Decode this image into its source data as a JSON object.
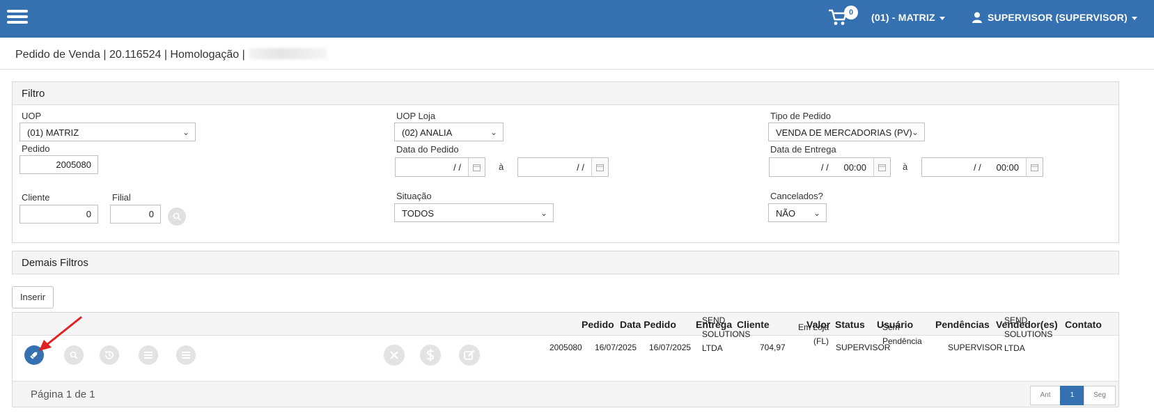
{
  "topbar": {
    "cart_count": "0",
    "branch_label": "(01) - MATRIZ",
    "user_label": "SUPERVISOR (SUPERVISOR)"
  },
  "header": {
    "title": "Pedido de Venda | 20.116524 | Homologação |"
  },
  "filtro": {
    "title": "Filtro",
    "uop": {
      "label": "UOP",
      "value": "(01) MATRIZ"
    },
    "uop_loja": {
      "label": "UOP Loja",
      "value": "(02) ANALIA"
    },
    "tipo_pedido": {
      "label": "Tipo de Pedido",
      "value": "VENDA DE MERCADORIAS (PV)"
    },
    "pedido": {
      "label": "Pedido",
      "value": "2005080"
    },
    "data_pedido": {
      "label": "Data do Pedido",
      "from": "/ /",
      "to": "/ /",
      "sep": "à"
    },
    "data_entrega": {
      "label": "Data de Entrega",
      "from": "/ /      00:00",
      "to": "/ /      00:00",
      "sep": "à"
    },
    "cliente": {
      "label": "Cliente",
      "value": "0"
    },
    "filial": {
      "label": "Filial",
      "value": "0"
    },
    "situacao": {
      "label": "Situação",
      "value": "TODOS"
    },
    "cancelados": {
      "label": "Cancelados?",
      "value": "NÃO"
    }
  },
  "demais_filtros": {
    "title": "Demais Filtros"
  },
  "actions": {
    "insert_label": "Inserir"
  },
  "table": {
    "headers": {
      "pedido": "Pedido",
      "data_pedido": "Data Pedido",
      "entrega": "Entrega",
      "cliente": "Cliente",
      "valor": "Valor",
      "status": "Status",
      "usuario": "Usuário",
      "pendencias": "Pendências",
      "vendedores": "Vendedor(es)",
      "contato": "Contato"
    },
    "rows": [
      {
        "pedido": "2005080",
        "data_pedido": "16/07/2025",
        "entrega": "16/07/2025",
        "cliente": "SEND SOLUTIONS LTDA",
        "valor": "704,97",
        "status": "Em Loja (FL)",
        "usuario": "SUPERVISOR",
        "pendencias": "Sem Pendência",
        "vendedores": "SUPERVISOR",
        "contato": "SEND SOLUTIONS LTDA"
      }
    ],
    "row_icons": [
      "edit-icon",
      "search-icon",
      "history-icon",
      "list-icon",
      "list-icon",
      "cancel-icon",
      "dollar-icon",
      "edit-note-icon"
    ],
    "page_info": "Página 1 de 1",
    "pager": {
      "prev": "Ant",
      "current": "1",
      "next": "Seg"
    }
  },
  "colors": {
    "brand": "#3571b1",
    "panel_bg": "#f5f5f5",
    "annotation_arrow": "#e02020"
  }
}
